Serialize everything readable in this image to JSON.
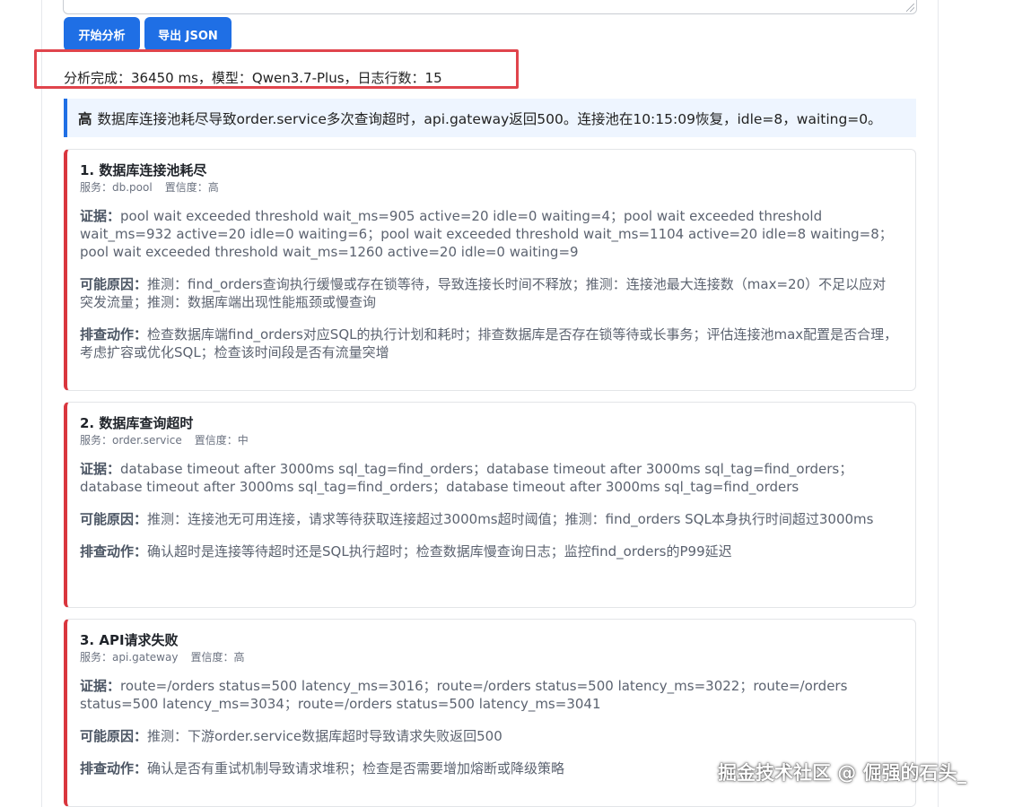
{
  "toolbar": {
    "analyze_label": "开始分析",
    "export_label": "导出 JSON"
  },
  "status": {
    "text": "分析完成：36450 ms，模型：Qwen3.7-Plus，日志行数：15",
    "highlight_color": "#e0444c"
  },
  "summary": {
    "severity": "高",
    "text": "数据库连接池耗尽导致order.service多次查询超时，api.gateway返回500。连接池在10:15:09恢复，idle=8，waiting=0。",
    "accent_color": "#1f6fe5"
  },
  "labels": {
    "evidence": "证据：",
    "cause": "可能原因：",
    "action": "排查动作："
  },
  "issues": [
    {
      "title": "1. 数据库连接池耗尽",
      "service": "服务：db.pool",
      "confidence": "置信度：高",
      "evidence": "pool wait exceeded threshold wait_ms=905 active=20 idle=0 waiting=4；pool wait exceeded threshold wait_ms=932 active=20 idle=0 waiting=6；pool wait exceeded threshold wait_ms=1104 active=20 idle=8 waiting=8；pool wait exceeded threshold wait_ms=1260 active=20 idle=0 waiting=9",
      "cause": "推测：find_orders查询执行缓慢或存在锁等待，导致连接长时间不释放；推测：连接池最大连接数（max=20）不足以应对突发流量；推测：数据库端出现性能瓶颈或慢查询",
      "action": "检查数据库端find_orders对应SQL的执行计划和耗时；排查数据库是否存在锁等待或长事务；评估连接池max配置是否合理，考虑扩容或优化SQL；检查该时间段是否有流量突增"
    },
    {
      "title": "2. 数据库查询超时",
      "service": "服务：order.service",
      "confidence": "置信度：中",
      "evidence": "database timeout after 3000ms sql_tag=find_orders；database timeout after 3000ms sql_tag=find_orders；database timeout after 3000ms sql_tag=find_orders；database timeout after 3000ms sql_tag=find_orders",
      "cause": "推测：连接池无可用连接，请求等待获取连接超过3000ms超时阈值；推测：find_orders SQL本身执行时间超过3000ms",
      "action": "确认超时是连接等待超时还是SQL执行超时；检查数据库慢查询日志；监控find_orders的P99延迟"
    },
    {
      "title": "3. API请求失败",
      "service": "服务：api.gateway",
      "confidence": "置信度：高",
      "evidence": "route=/orders status=500 latency_ms=3016；route=/orders status=500 latency_ms=3022；route=/orders status=500 latency_ms=3034；route=/orders status=500 latency_ms=3041",
      "cause": "推测：下游order.service数据库超时导致请求失败返回500",
      "action": "确认是否有重试机制导致请求堆积；检查是否需要增加熔断或降级策略"
    }
  ],
  "watermark": "掘金技术社区 @ 倔强的石头_"
}
